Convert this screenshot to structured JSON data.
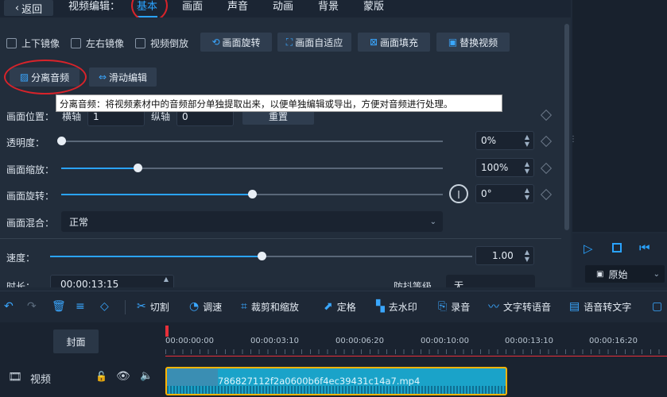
{
  "header": {
    "back_label": "返回",
    "section_label": "视频编辑：",
    "tabs": [
      "基本",
      "画面",
      "声音",
      "动画",
      "背景",
      "蒙版"
    ]
  },
  "options": {
    "flip_vertical": "上下镜像",
    "flip_horizontal": "左右镜像",
    "reverse": "视频倒放",
    "rotate": "画面旋转",
    "fit": "画面自适应",
    "fill": "画面填充",
    "replace": "替换视频",
    "split_audio": "分离音频",
    "scroll_edit": "滑动编辑"
  },
  "tooltip": "分离音频：将视频素材中的音频部分单独提取出来，以便单独编辑或导出，方便对音频进行处理。",
  "props": {
    "position_label": "画面位置：",
    "h_axis": "横轴",
    "h_value": "1",
    "v_axis": "纵轴",
    "v_value": "0",
    "reset": "重置",
    "opacity_label": "透明度：",
    "opacity_value": "0%",
    "scale_label": "画面缩放：",
    "scale_value": "100%",
    "rotate_label": "画面旋转：",
    "rotate_value": "0°",
    "blend_label": "画面混合：",
    "blend_value": "正常",
    "speed_label": "速度：",
    "speed_value": "1.00",
    "duration_label": "时长：",
    "duration_value": "00:00:13:15",
    "stabilize_label": "防抖等级",
    "stabilize_value": "无"
  },
  "sliders": {
    "opacity": 0,
    "scale": 0.2,
    "rotate": 0.5,
    "speed": 0.5
  },
  "preview": {
    "ratio_label": "原始"
  },
  "toolbar": {
    "cut": "切割",
    "speed": "调速",
    "crop_zoom": "裁剪和缩放",
    "freeze": "定格",
    "remove_watermark": "去水印",
    "record": "录音",
    "tts": "文字转语音",
    "stt": "语音转文字"
  },
  "timeline": {
    "cover": "封面",
    "video_track": "视频",
    "ticks": [
      "00:00:00:00",
      "00:00:03:10",
      "00:00:06:20",
      "00:00:10:00",
      "00:00:13:10",
      "00:00:16:20"
    ],
    "clip_name": "786827112f2a0600b6f4ec39431c14a7.mp4"
  },
  "colors": {
    "accent": "#2aa3ff",
    "annotation": "#d8232a",
    "clip": "#1aa3c9",
    "clip_border": "#ffb400"
  }
}
